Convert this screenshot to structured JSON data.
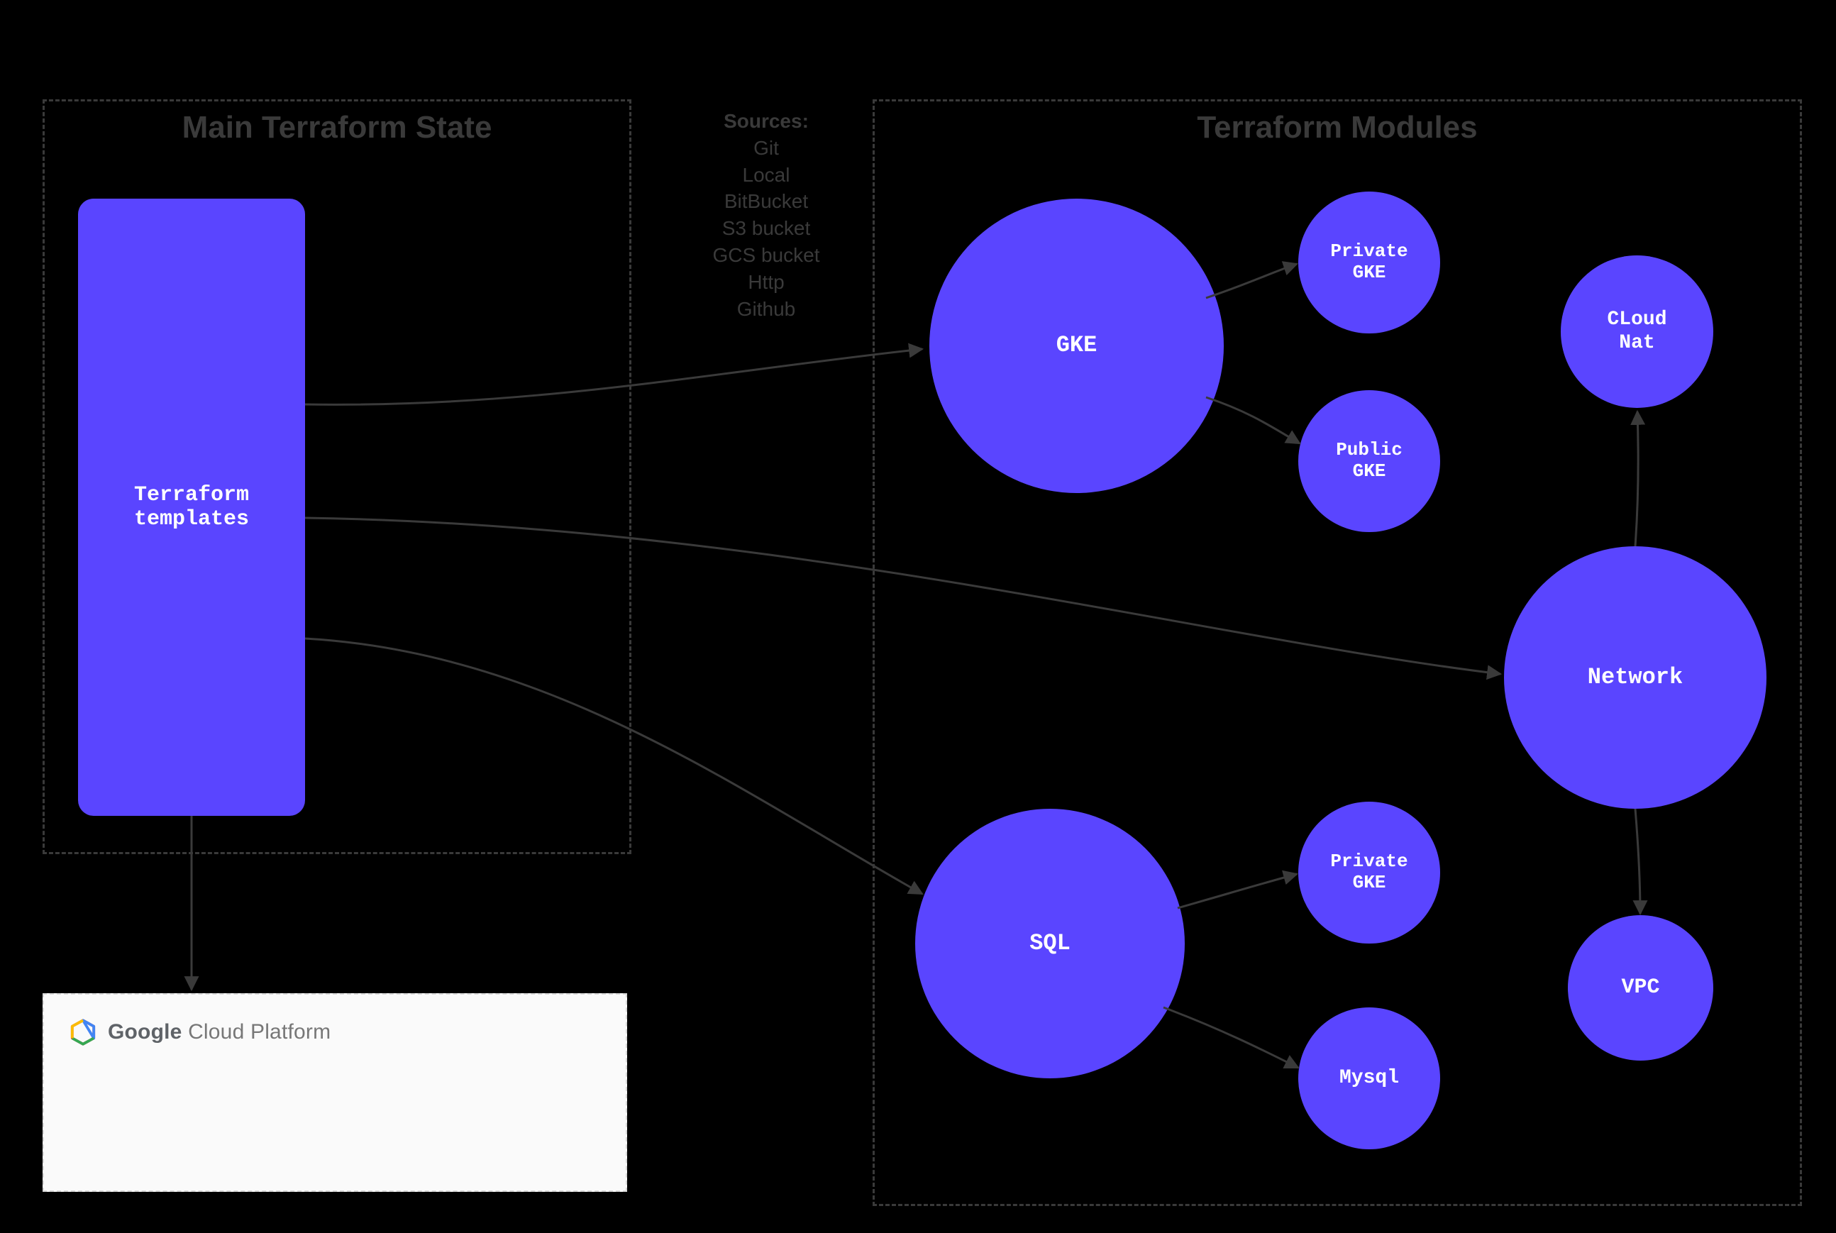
{
  "panels": {
    "state_title": "Main Terraform State",
    "modules_title": "Terraform Modules"
  },
  "sources": {
    "header": "Sources:",
    "items": [
      "Git",
      "Local",
      "BitBucket",
      "S3 bucket",
      "GCS bucket",
      "Http",
      "Github"
    ]
  },
  "nodes": {
    "templates": "Terraform\ntemplates",
    "gke": "GKE",
    "private_gke_1": "Private\nGKE",
    "public_gke": "Public\nGKE",
    "cloud_nat": "CLoud\nNat",
    "network": "Network",
    "sql": "SQL",
    "private_gke_2": "Private\nGKE",
    "mysql": "Mysql",
    "vpc": "VPC"
  },
  "gcp": {
    "brand_bold": "Google",
    "brand_rest": " Cloud Platform"
  },
  "colors": {
    "node": "#5A45FF",
    "edge": "#3a3a3a",
    "panel_border": "#3a3a3a"
  }
}
